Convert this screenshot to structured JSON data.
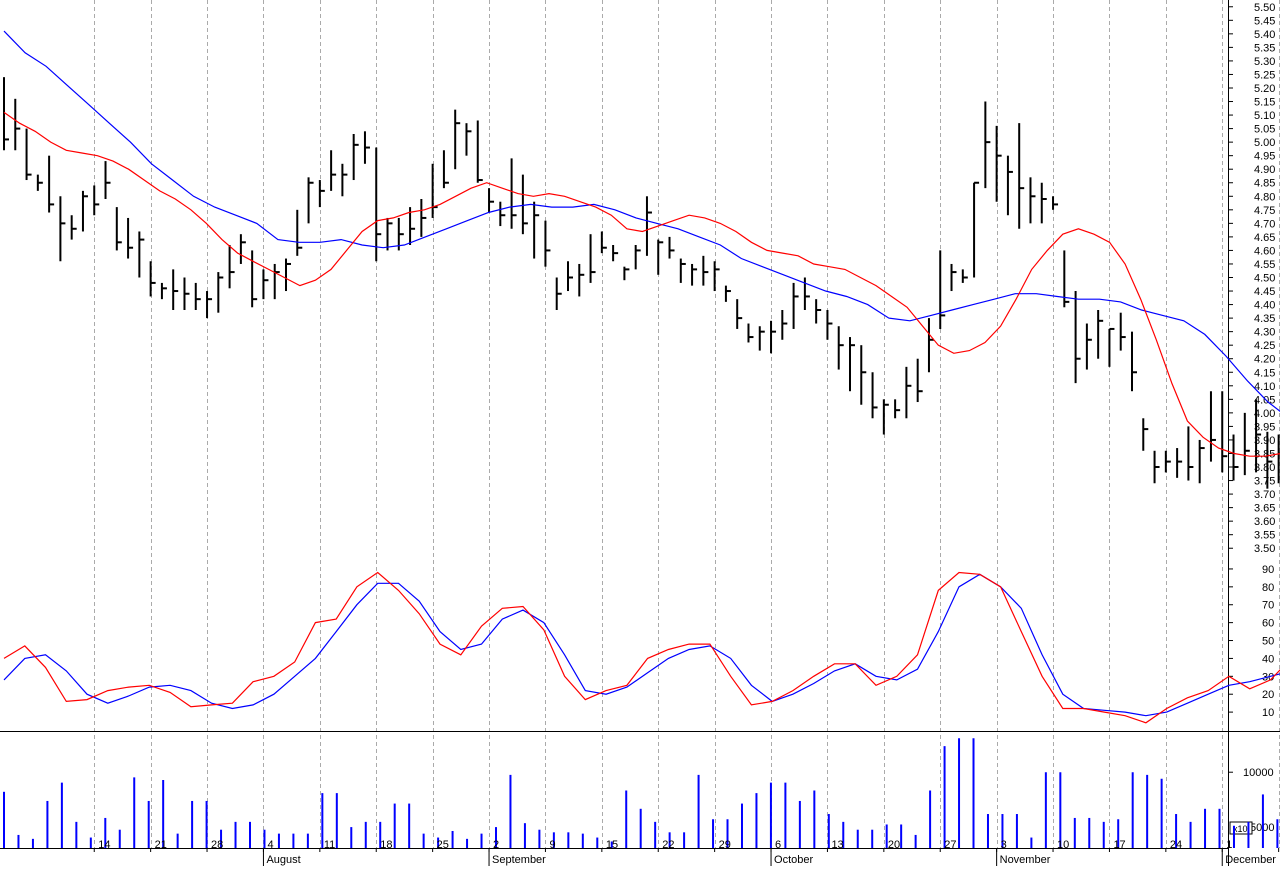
{
  "chart_data": {
    "type": "ohlc-bar-with-indicators",
    "colors": {
      "price_bars": "#000000",
      "fast_ma": "#ff0000",
      "slow_ma": "#0000ff",
      "stoch_k": "#ff0000",
      "stoch_d": "#0000ff",
      "volume": "#0000ff",
      "grid": "#aaaaaa"
    },
    "price_panel": {
      "ylim": [
        3.475,
        5.525
      ],
      "yticks": [
        "3.50",
        "3.55",
        "3.60",
        "3.65",
        "3.70",
        "3.75",
        "3.80",
        "3.85",
        "3.90",
        "3.95",
        "4.00",
        "4.05",
        "4.10",
        "4.15",
        "4.20",
        "4.25",
        "4.30",
        "4.35",
        "4.40",
        "4.45",
        "4.50",
        "4.55",
        "4.60",
        "4.65",
        "4.70",
        "4.75",
        "4.80",
        "4.85",
        "4.90",
        "4.95",
        "5.00",
        "5.05",
        "5.10",
        "5.15",
        "5.20",
        "5.25",
        "5.30",
        "5.35",
        "5.40",
        "5.45",
        "5.50"
      ],
      "bars": [
        [
          5.24,
          4.97,
          5.01
        ],
        [
          5.16,
          4.97,
          5.05
        ],
        [
          5.05,
          4.86,
          4.88
        ],
        [
          4.88,
          4.82,
          4.85
        ],
        [
          4.95,
          4.74,
          4.77
        ],
        [
          4.8,
          4.56,
          4.7
        ],
        [
          4.73,
          4.64,
          4.68
        ],
        [
          4.82,
          4.67,
          4.8
        ],
        [
          4.84,
          4.73,
          4.77
        ],
        [
          4.93,
          4.79,
          4.85
        ],
        [
          4.76,
          4.6,
          4.63
        ],
        [
          4.72,
          4.57,
          4.61
        ],
        [
          4.67,
          4.5,
          4.64
        ],
        [
          4.56,
          4.43,
          4.48
        ],
        [
          4.48,
          4.42,
          4.46
        ],
        [
          4.53,
          4.38,
          4.45
        ],
        [
          4.5,
          4.38,
          4.44
        ],
        [
          4.48,
          4.38,
          4.42
        ],
        [
          4.45,
          4.35,
          4.42
        ],
        [
          4.52,
          4.37,
          4.5
        ],
        [
          4.62,
          4.46,
          4.52
        ],
        [
          4.66,
          4.55,
          4.63
        ],
        [
          4.6,
          4.39,
          4.42
        ],
        [
          4.53,
          4.42,
          4.49
        ],
        [
          4.55,
          4.42,
          4.52
        ],
        [
          4.57,
          4.45,
          4.55
        ],
        [
          4.75,
          4.58,
          4.61
        ],
        [
          4.87,
          4.7,
          4.85
        ],
        [
          4.86,
          4.76,
          4.82
        ],
        [
          4.97,
          4.82,
          4.88
        ],
        [
          4.92,
          4.8,
          4.88
        ],
        [
          5.03,
          4.86,
          4.99
        ],
        [
          5.04,
          4.92,
          4.98
        ],
        [
          4.98,
          4.56,
          4.66
        ],
        [
          4.72,
          4.6,
          4.7
        ],
        [
          4.72,
          4.6,
          4.66
        ],
        [
          4.76,
          4.62,
          4.68
        ],
        [
          4.79,
          4.65,
          4.72
        ],
        [
          4.92,
          4.72,
          4.76
        ],
        [
          4.97,
          4.83,
          4.85
        ],
        [
          5.12,
          4.9,
          5.07
        ],
        [
          5.07,
          4.95,
          5.04
        ],
        [
          5.08,
          4.85,
          4.86
        ],
        [
          4.83,
          4.74,
          4.78
        ],
        [
          4.78,
          4.69,
          4.73
        ],
        [
          4.94,
          4.68,
          4.73
        ],
        [
          4.88,
          4.66,
          4.7
        ],
        [
          4.78,
          4.57,
          4.73
        ],
        [
          4.71,
          4.54,
          4.6
        ],
        [
          4.5,
          4.38,
          4.44
        ],
        [
          4.56,
          4.45,
          4.5
        ],
        [
          4.55,
          4.43,
          4.51
        ],
        [
          4.66,
          4.48,
          4.52
        ],
        [
          4.67,
          4.59,
          4.61
        ],
        [
          4.62,
          4.56,
          4.59
        ],
        [
          4.54,
          4.49,
          4.53
        ],
        [
          4.62,
          4.53,
          4.6
        ],
        [
          4.8,
          4.58,
          4.74
        ],
        [
          4.64,
          4.51,
          4.63
        ],
        [
          4.65,
          4.57,
          4.6
        ],
        [
          4.57,
          4.48,
          4.55
        ],
        [
          4.55,
          4.47,
          4.53
        ],
        [
          4.58,
          4.47,
          4.52
        ],
        [
          4.56,
          4.45,
          4.53
        ],
        [
          4.47,
          4.41,
          4.45
        ],
        [
          4.42,
          4.31,
          4.35
        ],
        [
          4.33,
          4.26,
          4.28
        ],
        [
          4.32,
          4.23,
          4.3
        ],
        [
          4.34,
          4.22,
          4.3
        ],
        [
          4.38,
          4.27,
          4.33
        ],
        [
          4.48,
          4.31,
          4.43
        ],
        [
          4.5,
          4.38,
          4.43
        ],
        [
          4.42,
          4.33,
          4.38
        ],
        [
          4.38,
          4.27,
          4.33
        ],
        [
          4.32,
          4.16,
          4.25
        ],
        [
          4.28,
          4.08,
          4.25
        ],
        [
          4.25,
          4.03,
          4.15
        ],
        [
          4.15,
          3.98,
          4.02
        ],
        [
          4.05,
          3.92,
          4.03
        ],
        [
          4.05,
          3.98,
          4.01
        ],
        [
          4.17,
          3.98,
          4.1
        ],
        [
          4.2,
          4.04,
          4.08
        ],
        [
          4.35,
          4.15,
          4.27
        ],
        [
          4.6,
          4.31,
          4.36
        ],
        [
          4.55,
          4.45,
          4.52
        ],
        [
          4.53,
          4.48,
          4.5
        ],
        [
          4.85,
          4.5,
          4.85
        ],
        [
          5.15,
          4.83,
          5.0
        ],
        [
          5.06,
          4.78,
          4.95
        ],
        [
          4.95,
          4.73,
          4.89
        ],
        [
          5.07,
          4.68,
          4.83
        ],
        [
          4.87,
          4.7,
          4.8
        ],
        [
          4.85,
          4.7,
          4.79
        ],
        [
          4.8,
          4.75,
          4.77
        ],
        [
          4.6,
          4.39,
          4.41
        ],
        [
          4.45,
          4.11,
          4.2
        ],
        [
          4.33,
          4.16,
          4.27
        ],
        [
          4.38,
          4.2,
          4.34
        ],
        [
          4.31,
          4.17,
          4.31
        ],
        [
          4.37,
          4.23,
          4.28
        ],
        [
          4.3,
          4.08,
          4.15
        ],
        [
          3.98,
          3.86,
          3.94
        ],
        [
          3.86,
          3.74,
          3.8
        ],
        [
          3.86,
          3.78,
          3.82
        ],
        [
          3.87,
          3.76,
          3.82
        ],
        [
          3.95,
          3.75,
          3.8
        ],
        [
          3.9,
          3.74,
          3.87
        ],
        [
          4.08,
          3.82,
          3.9
        ],
        [
          4.08,
          3.78,
          3.84
        ],
        [
          3.92,
          3.75,
          3.8
        ],
        [
          4.0,
          3.77,
          3.86
        ],
        [
          4.05,
          3.78,
          3.92
        ],
        [
          3.93,
          3.72,
          3.82
        ],
        [
          3.92,
          3.74,
          3.85
        ],
        [
          3.86,
          3.71,
          3.82
        ],
        [
          4.0,
          3.74,
          3.85
        ],
        [
          3.96,
          3.76,
          3.9
        ],
        [
          4.33,
          3.83,
          4.21
        ],
        [
          3.94,
          3.81,
          3.91
        ],
        [
          3.9,
          3.73,
          3.82
        ],
        [
          3.97,
          3.81,
          3.9
        ],
        [
          4.0,
          3.83,
          3.88
        ],
        [
          4.03,
          3.75,
          3.87
        ],
        [
          3.8,
          3.65,
          3.73
        ],
        [
          3.76,
          3.68,
          3.72
        ],
        [
          3.8,
          3.72,
          3.73
        ],
        [
          4.02,
          3.71,
          3.93
        ],
        [
          4.15,
          3.9,
          3.96
        ]
      ],
      "fast_ma": [
        5.11,
        5.07,
        5.04,
        5.0,
        4.97,
        4.96,
        4.95,
        4.93,
        4.9,
        4.86,
        4.82,
        4.79,
        4.75,
        4.7,
        4.64,
        4.59,
        4.56,
        4.53,
        4.5,
        4.47,
        4.49,
        4.53,
        4.6,
        4.67,
        4.71,
        4.72,
        4.74,
        4.75,
        4.77,
        4.8,
        4.83,
        4.85,
        4.83,
        4.81,
        4.8,
        4.81,
        4.8,
        4.78,
        4.76,
        4.73,
        4.68,
        4.67,
        4.69,
        4.71,
        4.73,
        4.72,
        4.7,
        4.67,
        4.63,
        4.6,
        4.59,
        4.58,
        4.55,
        4.54,
        4.53,
        4.5,
        4.47,
        4.43,
        4.39,
        4.32,
        4.25,
        4.22,
        4.23,
        4.26,
        4.32,
        4.42,
        4.53,
        4.6,
        4.66,
        4.68,
        4.66,
        4.63,
        4.55,
        4.42,
        4.27,
        4.11,
        3.97,
        3.91,
        3.87,
        3.85,
        3.84,
        3.84,
        3.85,
        3.86,
        3.87,
        3.87,
        3.88,
        3.89,
        3.89,
        3.88,
        3.87,
        3.89,
        3.89
      ],
      "slow_ma": [
        5.41,
        5.33,
        5.28,
        5.21,
        5.14,
        5.07,
        5.0,
        4.92,
        4.86,
        4.8,
        4.76,
        4.73,
        4.7,
        4.64,
        4.63,
        4.63,
        4.64,
        4.62,
        4.61,
        4.62,
        4.65,
        4.68,
        4.71,
        4.74,
        4.76,
        4.77,
        4.76,
        4.76,
        4.77,
        4.75,
        4.72,
        4.7,
        4.68,
        4.65,
        4.62,
        4.57,
        4.54,
        4.51,
        4.48,
        4.45,
        4.43,
        4.4,
        4.35,
        4.34,
        4.36,
        4.38,
        4.4,
        4.42,
        4.44,
        4.44,
        4.43,
        4.42,
        4.42,
        4.41,
        4.38,
        4.36,
        4.34,
        4.29,
        4.21,
        4.12,
        4.04,
        3.98,
        3.94,
        3.91,
        3.9,
        3.88,
        3.86,
        3.87,
        3.88
      ]
    },
    "stoch_panel": {
      "ylim": [
        0,
        95
      ],
      "yticks": [
        "10",
        "20",
        "30",
        "40",
        "50",
        "60",
        "70",
        "80",
        "90"
      ],
      "k": [
        40,
        47,
        35,
        16,
        17,
        22,
        24,
        25,
        21,
        13,
        14,
        15,
        27,
        30,
        38,
        60,
        62,
        80,
        88,
        78,
        65,
        48,
        42,
        58,
        68,
        69,
        56,
        30,
        17,
        22,
        25,
        40,
        45,
        48,
        48,
        30,
        14,
        16,
        22,
        30,
        37,
        37,
        25,
        30,
        42,
        78,
        88,
        87,
        80,
        55,
        30,
        12,
        12,
        10,
        8,
        4,
        12,
        18,
        22,
        30,
        23,
        28,
        40,
        33,
        52,
        50,
        42,
        22,
        20,
        27
      ],
      "d": [
        28,
        40,
        42,
        33,
        20,
        15,
        19,
        24,
        25,
        22,
        15,
        12,
        14,
        20,
        30,
        40,
        55,
        70,
        82,
        82,
        72,
        55,
        45,
        48,
        62,
        67,
        60,
        42,
        22,
        20,
        24,
        32,
        40,
        45,
        47,
        40,
        25,
        16,
        20,
        26,
        33,
        37,
        30,
        28,
        34,
        55,
        80,
        87,
        80,
        68,
        42,
        20,
        12,
        11,
        10,
        8,
        10,
        15,
        20,
        25,
        27,
        30,
        33,
        37,
        45,
        50,
        45,
        32,
        22,
        25
      ]
    },
    "volume_panel": {
      "ytick_labels": [
        "10000",
        "5000"
      ],
      "multiplier_label": "x10",
      "volumes": [
        8500,
        5200,
        4900,
        7800,
        9200,
        6200,
        5000,
        6500,
        5600,
        9600,
        7800,
        9400,
        5300,
        7800,
        7800,
        5600,
        6200,
        6200,
        5600,
        5300,
        5300,
        5300,
        8400,
        8400,
        5800,
        6200,
        6200,
        7600,
        7600,
        5300,
        5000,
        5500,
        4900,
        5300,
        5800,
        9800,
        6100,
        5600,
        5400,
        5400,
        5300,
        5000,
        4700,
        8600,
        7200,
        6200,
        5400,
        5400,
        9800,
        6400,
        6400,
        7600,
        8400,
        9200,
        9200,
        7800,
        8600,
        6800,
        6200,
        5600,
        5600,
        6000,
        6000,
        5200,
        8600,
        12000,
        12600,
        12600,
        6800,
        6800,
        6800,
        5000,
        10000,
        10000,
        6500,
        6500,
        6200,
        6400,
        10000,
        9800,
        9500,
        6800,
        6200,
        7200,
        7200,
        5900,
        6200,
        8300,
        6400,
        6000,
        6600,
        6500,
        11000,
        8200,
        7600,
        6800,
        7000,
        7800,
        7800,
        8300
      ],
      "vlim": [
        4200,
        13000
      ]
    },
    "x_axis": {
      "labels": [
        {
          "text": "14",
          "index": 8
        },
        {
          "text": "21",
          "index": 13
        },
        {
          "text": "28",
          "index": 18
        },
        {
          "text": "4",
          "index": 23
        },
        {
          "text": "11",
          "index": 28
        },
        {
          "text": "18",
          "index": 33
        },
        {
          "text": "25",
          "index": 38
        },
        {
          "text": "2",
          "index": 43
        },
        {
          "text": "9",
          "index": 48
        },
        {
          "text": "15",
          "index": 53
        },
        {
          "text": "22",
          "index": 58
        },
        {
          "text": "29",
          "index": 63
        },
        {
          "text": "6",
          "index": 68
        },
        {
          "text": "13",
          "index": 73
        },
        {
          "text": "20",
          "index": 78
        },
        {
          "text": "27",
          "index": 83
        },
        {
          "text": "3",
          "index": 88
        },
        {
          "text": "10",
          "index": 93
        },
        {
          "text": "17",
          "index": 98
        },
        {
          "text": "24",
          "index": 103
        },
        {
          "text": "1",
          "index": 108
        },
        {
          "text": "8",
          "index": 113
        }
      ],
      "months": [
        {
          "text": "August",
          "index": 23
        },
        {
          "text": "September",
          "index": 43
        },
        {
          "text": "October",
          "index": 68
        },
        {
          "text": "November",
          "index": 88
        },
        {
          "text": "December",
          "index": 108
        }
      ]
    }
  }
}
